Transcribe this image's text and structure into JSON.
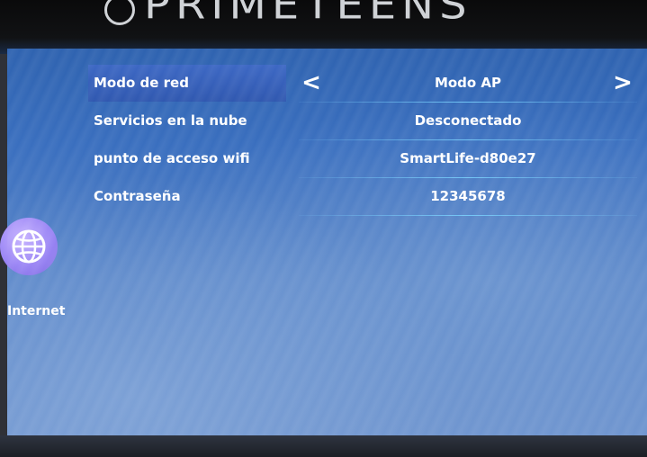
{
  "brand": {
    "text": "PRIMETEENS"
  },
  "sidebar": {
    "items": [
      {
        "label": "Internet",
        "icon": "globe-icon"
      }
    ]
  },
  "settings": {
    "rows": [
      {
        "label": "Modo de red",
        "value": "Modo AP",
        "selected": true
      },
      {
        "label": "Servicios en la nube",
        "value": "Desconectado"
      },
      {
        "label": "punto de acceso wifi",
        "value": "SmartLife-d80e27"
      },
      {
        "label": "Contraseña",
        "value": "12345678"
      }
    ],
    "prev_symbol": "<",
    "next_symbol": ">"
  },
  "colors": {
    "screen_top": "#2f63b0",
    "screen_bottom": "#6f95cf",
    "selected_label": "#3d68c4",
    "divider": "#78d2ff",
    "nav_icon": "#9b86f5"
  }
}
